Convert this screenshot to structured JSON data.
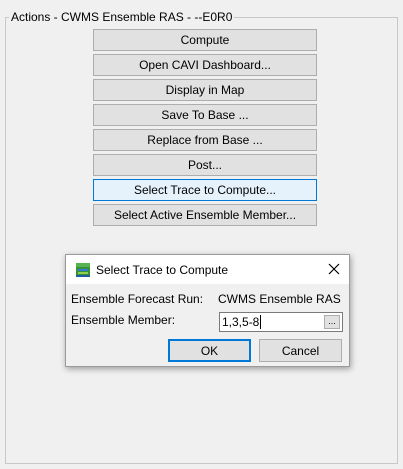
{
  "actions_panel": {
    "title": "Actions - CWMS Ensemble RAS - --E0R0",
    "buttons": [
      "Compute",
      "Open CAVI Dashboard...",
      "Display in Map",
      "Save To Base ...",
      "Replace from Base ...",
      "Post...",
      "Select Trace to Compute...",
      "Select Active Ensemble Member..."
    ]
  },
  "dialog": {
    "title": "Select Trace to Compute",
    "forecast_run_label": "Ensemble Forecast Run:",
    "forecast_run_value": "CWMS Ensemble RAS",
    "member_label": "Ensemble Member:",
    "member_value": "1,3,5-8",
    "browse_label": "...",
    "ok_label": "OK",
    "cancel_label": "Cancel",
    "icon": "app-icon",
    "close_icon": "close-icon"
  },
  "colors": {
    "background": "#f0f0f0",
    "button_face": "#e1e1e1",
    "focus_accent": "#0078d7",
    "focus_fill": "#e5f1fb"
  }
}
